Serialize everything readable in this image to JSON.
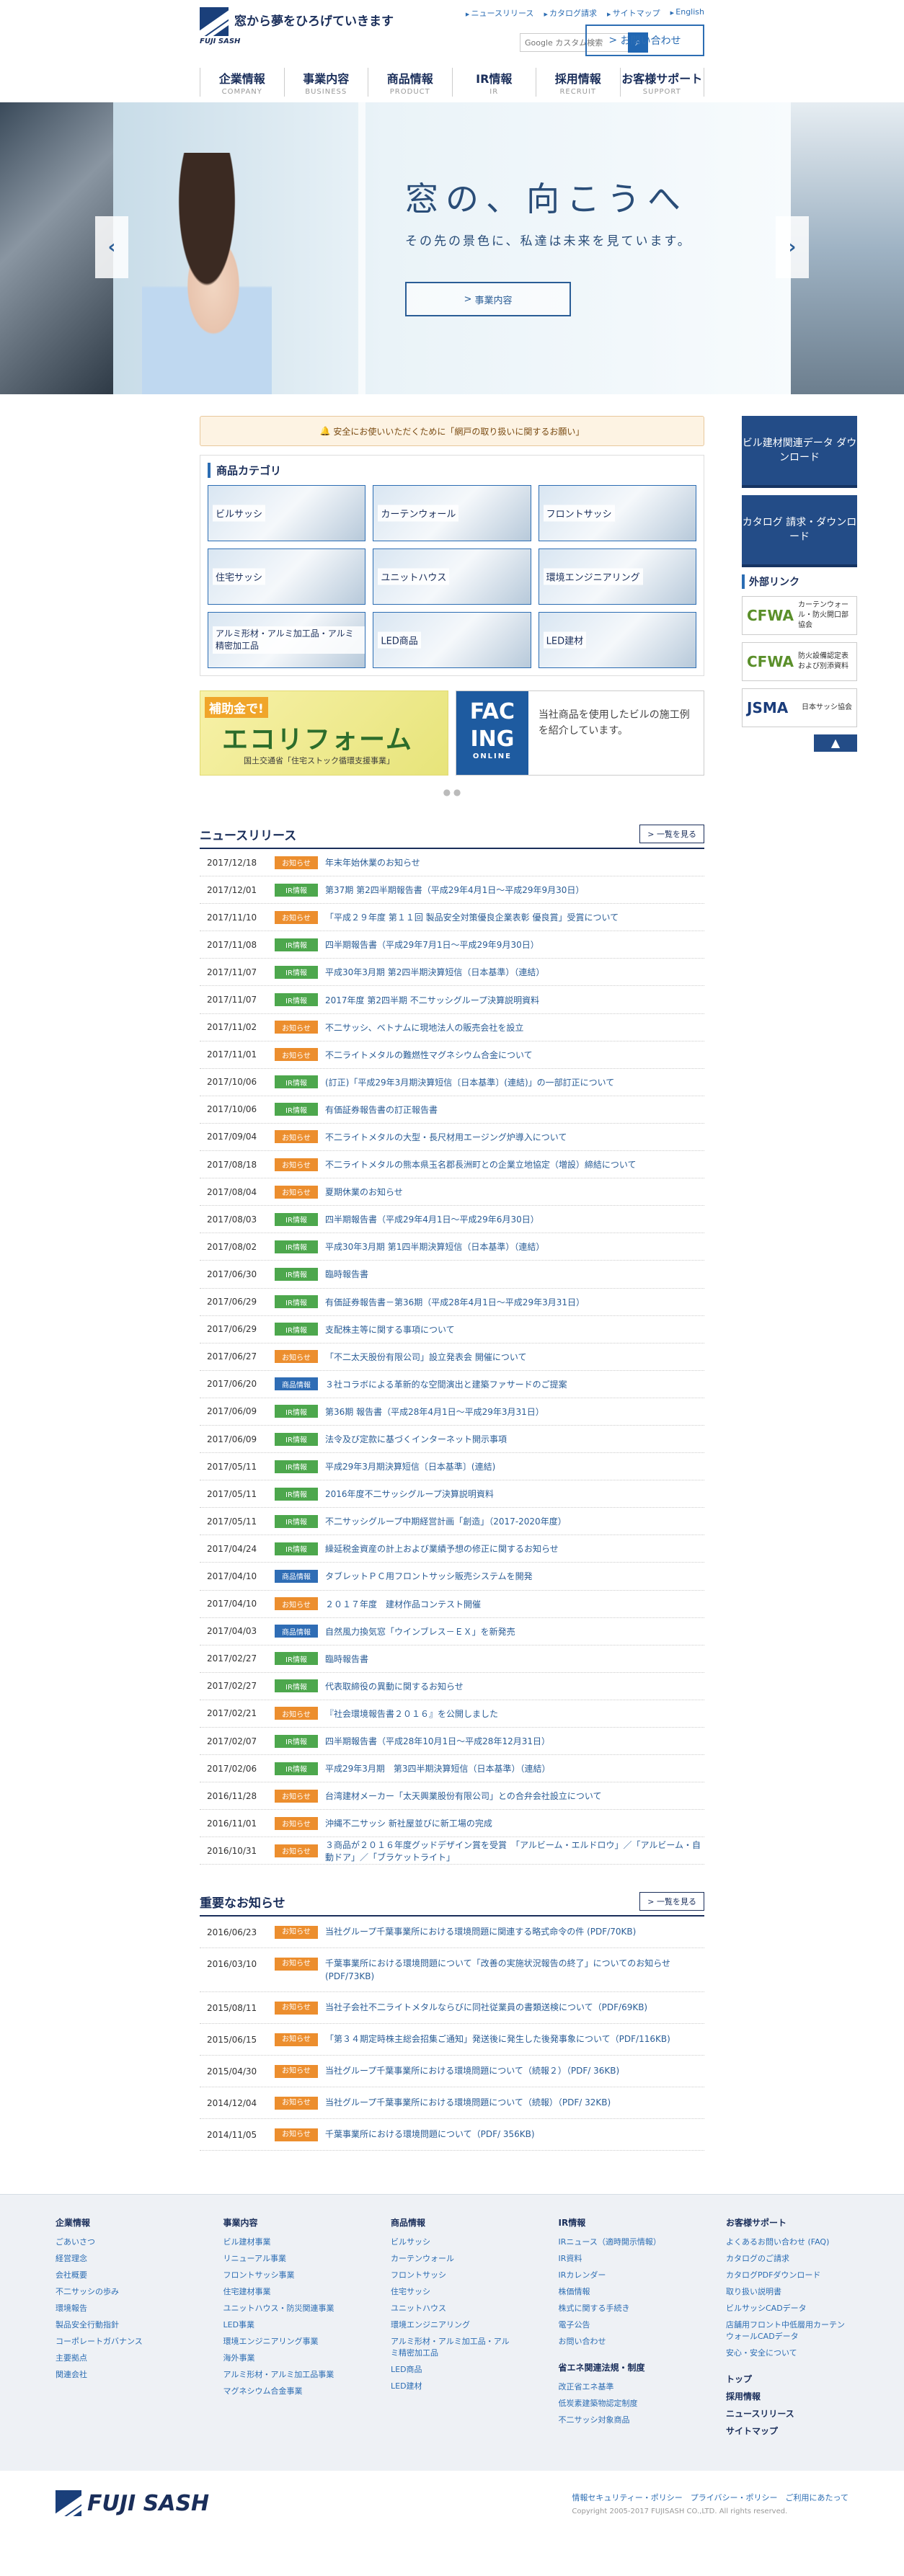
{
  "header": {
    "logo_text": "窓から夢をひろげていきます",
    "logo_sub": "FUJI SASH",
    "util": [
      "ニュースリリース",
      "カタログ請求",
      "サイトマップ",
      "English"
    ],
    "search_placeholder": "Google カスタム検索",
    "contact": "お問い合わせ",
    "nav": [
      {
        "jp": "企業情報",
        "en": "COMPANY"
      },
      {
        "jp": "事業内容",
        "en": "BUSINESS"
      },
      {
        "jp": "商品情報",
        "en": "PRODUCT"
      },
      {
        "jp": "IR情報",
        "en": "IR"
      },
      {
        "jp": "採用情報",
        "en": "RECRUIT"
      },
      {
        "jp": "お客様サポート",
        "en": "SUPPORT"
      }
    ]
  },
  "hero": {
    "title": "窓の、向こうへ",
    "subtitle": "その先の景色に、私達は未来を見ています。",
    "button": "事業内容"
  },
  "notice": "安全にお使いいただくために「網戸の取り扱いに関するお願い」",
  "categories": {
    "title": "商品カテゴリ",
    "items": [
      "ビルサッシ",
      "カーテンウォール",
      "フロントサッシ",
      "住宅サッシ",
      "ユニットハウス",
      "環境エンジニアリング",
      "アルミ形材・アルミ加工品・アルミ精密加工品",
      "LED商品",
      "LED建材"
    ]
  },
  "banners": {
    "eco_tag": "補助金で!",
    "eco_main": "エコリフォーム",
    "eco_small": "国土交通省「住宅ストック循環支援事業」",
    "fac_logo1": "FAC",
    "fac_logo2": "ING",
    "fac_logo3": "ONLINE",
    "fac_text": "当社商品を使用したビルの施工例を紹介しています。",
    "dots": "● ●"
  },
  "side": {
    "btn1": "ビル建材関連データ ダウンロード",
    "btn2": "カタログ 請求・ダウンロード",
    "ext_title": "外部リンク",
    "ext": [
      {
        "logo": "CFWA",
        "text": "カーテンウォール・防火開口部協会"
      },
      {
        "logo": "CFWA",
        "text": "防火設備認定表および別添資料"
      },
      {
        "logo": "JSMA",
        "text": "日本サッシ協会"
      }
    ],
    "pagetop": "▲"
  },
  "news": {
    "title": "ニュースリリース",
    "more": "一覧を見る",
    "items": [
      {
        "d": "2017/12/18",
        "tag": "お知らせ",
        "c": "o",
        "t": "年末年始休業のお知らせ"
      },
      {
        "d": "2017/12/01",
        "tag": "IR情報",
        "c": "g",
        "t": "第37期 第2四半期報告書（平成29年4月1日～平成29年9月30日）"
      },
      {
        "d": "2017/11/10",
        "tag": "お知らせ",
        "c": "o",
        "t": "「平成２９年度 第１１回 製品安全対策優良企業表彰 優良賞」受賞について"
      },
      {
        "d": "2017/11/08",
        "tag": "IR情報",
        "c": "g",
        "t": "四半期報告書（平成29年7月1日～平成29年9月30日）"
      },
      {
        "d": "2017/11/07",
        "tag": "IR情報",
        "c": "g",
        "t": "平成30年3月期 第2四半期決算短信（日本基準）（連結）"
      },
      {
        "d": "2017/11/07",
        "tag": "IR情報",
        "c": "g",
        "t": "2017年度 第2四半期 不二サッシグループ決算説明資料"
      },
      {
        "d": "2017/11/02",
        "tag": "お知らせ",
        "c": "o",
        "t": "不二サッシ、ベトナムに現地法人の販売会社を設立"
      },
      {
        "d": "2017/11/01",
        "tag": "お知らせ",
        "c": "o",
        "t": "不二ライトメタルの難燃性マグネシウム合金について"
      },
      {
        "d": "2017/10/06",
        "tag": "IR情報",
        "c": "g",
        "t": "(訂正)「平成29年3月期決算短信〔日本基準〕(連結)」の一部訂正について"
      },
      {
        "d": "2017/10/06",
        "tag": "IR情報",
        "c": "g",
        "t": "有価証券報告書の訂正報告書"
      },
      {
        "d": "2017/09/04",
        "tag": "お知らせ",
        "c": "o",
        "t": "不二ライトメタルの大型・長尺材用エージング炉導入について"
      },
      {
        "d": "2017/08/18",
        "tag": "お知らせ",
        "c": "o",
        "t": "不二ライトメタルの熊本県玉名郡長洲町との企業立地協定（増設）締結について"
      },
      {
        "d": "2017/08/04",
        "tag": "お知らせ",
        "c": "o",
        "t": "夏期休業のお知らせ"
      },
      {
        "d": "2017/08/03",
        "tag": "IR情報",
        "c": "g",
        "t": "四半期報告書（平成29年4月1日～平成29年6月30日）"
      },
      {
        "d": "2017/08/02",
        "tag": "IR情報",
        "c": "g",
        "t": "平成30年3月期 第1四半期決算短信（日本基準）（連結）"
      },
      {
        "d": "2017/06/30",
        "tag": "IR情報",
        "c": "g",
        "t": "臨時報告書"
      },
      {
        "d": "2017/06/29",
        "tag": "IR情報",
        "c": "g",
        "t": "有価証券報告書－第36期（平成28年4月1日～平成29年3月31日）"
      },
      {
        "d": "2017/06/29",
        "tag": "IR情報",
        "c": "g",
        "t": "支配株主等に関する事項について"
      },
      {
        "d": "2017/06/27",
        "tag": "お知らせ",
        "c": "o",
        "t": "「不二太天股份有限公司」設立発表会 開催について"
      },
      {
        "d": "2017/06/20",
        "tag": "商品情報",
        "c": "b",
        "t": "３社コラボによる革新的な空間演出と建築ファサードのご提案"
      },
      {
        "d": "2017/06/09",
        "tag": "IR情報",
        "c": "g",
        "t": "第36期 報告書（平成28年4月1日～平成29年3月31日）"
      },
      {
        "d": "2017/06/09",
        "tag": "IR情報",
        "c": "g",
        "t": "法令及び定款に基づくインターネット開示事項"
      },
      {
        "d": "2017/05/11",
        "tag": "IR情報",
        "c": "g",
        "t": "平成29年3月期決算短信〔日本基準〕(連結)"
      },
      {
        "d": "2017/05/11",
        "tag": "IR情報",
        "c": "g",
        "t": "2016年度不二サッシグループ決算説明資料"
      },
      {
        "d": "2017/05/11",
        "tag": "IR情報",
        "c": "g",
        "t": "不二サッシグループ中期経営計画「創造」（2017-2020年度）"
      },
      {
        "d": "2017/04/24",
        "tag": "IR情報",
        "c": "g",
        "t": "繰延税金資産の計上および業績予想の修正に関するお知らせ"
      },
      {
        "d": "2017/04/10",
        "tag": "商品情報",
        "c": "b",
        "t": "タブレットＰＣ用フロントサッシ販売システムを開発"
      },
      {
        "d": "2017/04/10",
        "tag": "お知らせ",
        "c": "o",
        "t": "２０１７年度　建材作品コンテスト開催"
      },
      {
        "d": "2017/04/03",
        "tag": "商品情報",
        "c": "b",
        "t": "自然風力換気窓「ウインブレス－ＥＸ」を新発売"
      },
      {
        "d": "2017/02/27",
        "tag": "IR情報",
        "c": "g",
        "t": "臨時報告書"
      },
      {
        "d": "2017/02/27",
        "tag": "IR情報",
        "c": "g",
        "t": "代表取締役の異動に関するお知らせ"
      },
      {
        "d": "2017/02/21",
        "tag": "お知らせ",
        "c": "o",
        "t": "『社会環境報告書２０１６』を公開しました"
      },
      {
        "d": "2017/02/07",
        "tag": "IR情報",
        "c": "g",
        "t": "四半期報告書（平成28年10月1日～平成28年12月31日）"
      },
      {
        "d": "2017/02/06",
        "tag": "IR情報",
        "c": "g",
        "t": "平成29年3月期　第3四半期決算短信（日本基準）（連結）"
      },
      {
        "d": "2016/11/28",
        "tag": "お知らせ",
        "c": "o",
        "t": "台湾建材メーカー「太天興業股份有限公司」との合弁会社設立について"
      },
      {
        "d": "2016/11/01",
        "tag": "お知らせ",
        "c": "o",
        "t": "沖縄不二サッシ 新社屋並びに新工場の完成"
      },
      {
        "d": "2016/10/31",
        "tag": "お知らせ",
        "c": "o",
        "t": "３商品が２０１６年度グッドデザイン賞を受賞　「アルビーム・エルドロウ」／「アルビーム・自動ドア」／「ブラケットライト」"
      }
    ]
  },
  "important": {
    "title": "重要なお知らせ",
    "more": "一覧を見る",
    "items": [
      {
        "d": "2016/06/23",
        "tag": "お知らせ",
        "t": "当社グループ千葉事業所における環境問題に関連する略式命令の件 (PDF/70KB)"
      },
      {
        "d": "2016/03/10",
        "tag": "お知らせ",
        "t": "千葉事業所における環境問題について「改善の実施状況報告の終了」についてのお知らせ(PDF/73KB)"
      },
      {
        "d": "2015/08/11",
        "tag": "お知らせ",
        "t": "当社子会社不二ライトメタルならびに同社従業員の書類送検について（PDF/69KB)"
      },
      {
        "d": "2015/06/15",
        "tag": "お知らせ",
        "t": "「第３４期定時株主総会招集ご通知」発送後に発生した後発事象について（PDF/116KB)"
      },
      {
        "d": "2015/04/30",
        "tag": "お知らせ",
        "t": "当社グループ千葉事業所における環境問題について（続報２）（PDF/ 36KB)"
      },
      {
        "d": "2014/12/04",
        "tag": "お知らせ",
        "t": "当社グループ千葉事業所における環境問題について（続報）（PDF/ 32KB)"
      },
      {
        "d": "2014/11/05",
        "tag": "お知らせ",
        "t": "千葉事業所における環境問題について（PDF/ 356KB)"
      }
    ]
  },
  "footer": {
    "cols": [
      {
        "h": "企業情報",
        "items": [
          "ごあいさつ",
          "経営理念",
          "会社概要",
          "不二サッシの歩み",
          "環境報告",
          "製品安全行動指針",
          "コーポレートガバナンス",
          "主要拠点",
          "関連会社"
        ]
      },
      {
        "h": "事業内容",
        "items": [
          "ビル建材事業",
          "リニューアル事業",
          "フロントサッシ事業",
          "住宅建材事業",
          "ユニットハウス・防災関連事業",
          "LED事業",
          "環境エンジニアリング事業",
          "海外事業",
          "アルミ形材・アルミ加工品事業",
          "マグネシウム合金事業"
        ]
      },
      {
        "h": "商品情報",
        "items": [
          "ビルサッシ",
          "カーテンウォール",
          "フロントサッシ",
          "住宅サッシ",
          "ユニットハウス",
          "環境エンジニアリング",
          "アルミ形材・アルミ加工品・アルミ精密加工品",
          "LED商品",
          "LED建材"
        ]
      },
      {
        "h": "IR情報",
        "items": [
          "IRニュース（適時開示情報）",
          "IR資料",
          "IRカレンダー",
          "株価情報",
          "株式に関する手続き",
          "電子公告",
          "お問い合わせ"
        ],
        "sub_h": "省エネ関連法規・制度",
        "sub": [
          "改正省エネ基準",
          "低炭素建築物認定制度",
          "不二サッシ対象商品"
        ]
      },
      {
        "h": "お客様サポート",
        "items": [
          "よくあるお問い合わせ (FAQ)",
          "カタログのご請求",
          "カタログPDFダウンロード",
          "取り扱い説明書",
          "ビルサッシCADデータ",
          "店舗用フロント中低層用カーテンウォールCADデータ",
          "安心・安全について"
        ],
        "sub": [
          "トップ",
          "採用情報",
          "ニュースリリース",
          "サイトマップ"
        ]
      }
    ],
    "logo": "FUJI SASH",
    "links": "情報セキュリティー・ポリシー　プライバシー・ポリシー　ご利用にあたって",
    "copy": "Copyright 2005-2017 FUJISASH CO.,LTD. All rights reserved."
  }
}
